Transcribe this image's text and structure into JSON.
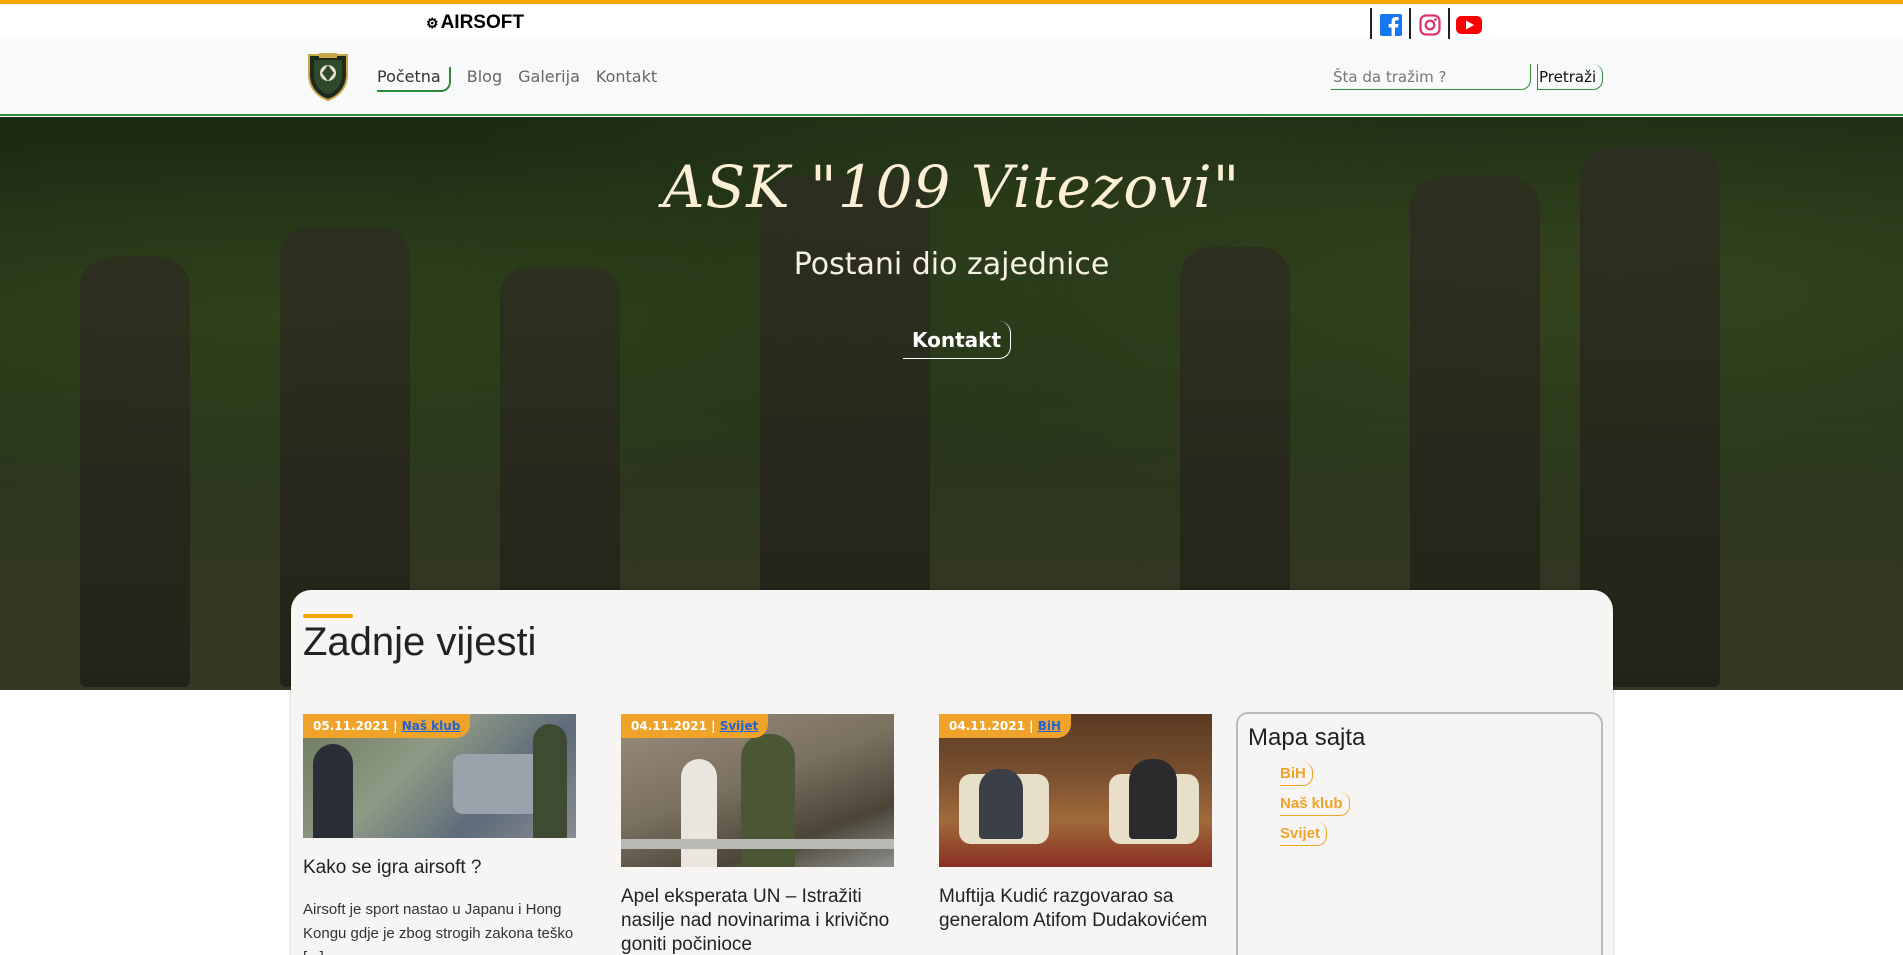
{
  "brand": {
    "name": "AIRSOFT",
    "icon": "gear-icon"
  },
  "social": [
    {
      "name": "facebook-icon",
      "color": "#1877f2"
    },
    {
      "name": "instagram-icon",
      "color": "#e1306c"
    },
    {
      "name": "youtube-icon",
      "color": "#ff0000"
    }
  ],
  "nav": {
    "items": [
      "Početna",
      "Blog",
      "Galerija",
      "Kontakt"
    ],
    "active": "Početna"
  },
  "search": {
    "placeholder": "Šta da tražim ?",
    "button": "Pretraži"
  },
  "hero": {
    "title": "ASK \"109 Vitezovi\"",
    "subtitle": "Postani dio zajednice",
    "button": "Kontakt"
  },
  "section": {
    "title": "Zadnje vijesti"
  },
  "posts": [
    {
      "date": "05.11.2021",
      "sep": "|",
      "category": "Naš klub",
      "title": "Kako se igra airsoft ?",
      "excerpt": "Airsoft je sport nastao u Japanu i Hong Kongu gdje je zbog strogih zakona teško [...]"
    },
    {
      "date": "04.11.2021",
      "sep": "|",
      "category": "Svijet",
      "title": "Apel eksperata UN – Istražiti nasilje nad novinarima i krivično goniti počinioce",
      "excerpt": ""
    },
    {
      "date": "04.11.2021",
      "sep": "|",
      "category": "BiH",
      "title": "Muftija Kudić razgovarao sa generalom Atifom Dudakovićem",
      "excerpt": ""
    }
  ],
  "sitemap": {
    "title": "Mapa sajta",
    "links": [
      "BiH",
      "Naš klub",
      "Svijet"
    ]
  },
  "colors": {
    "accent": "#f7a600",
    "green": "#2e8b3a",
    "link": "#f0a32a"
  }
}
